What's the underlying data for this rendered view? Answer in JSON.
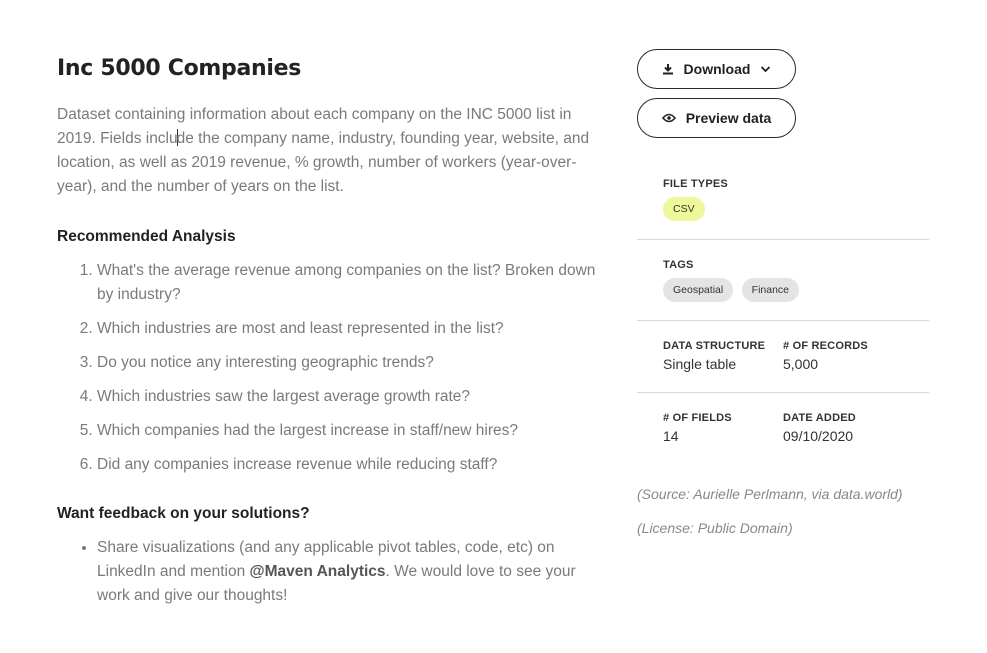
{
  "dataset": {
    "title": "Inc 5000 Companies",
    "description_part1": "Dataset containing information about each company on the INC 5000 list in 2019. Fields inclu",
    "description_part2": "de the company name, industry, founding year, website, and location, as well as 2019 revenue, % growth, number of workers (year-over-year), and the number of years on the list."
  },
  "analysis": {
    "heading": "Recommended Analysis",
    "items": [
      "What's the average revenue among companies on the list? Broken down by industry?",
      "Which industries are most and least represented in the list?",
      "Do you notice any interesting geographic trends?",
      "Which industries saw the largest average growth rate?",
      "Which companies had the largest increase in staff/new hires?",
      "Did any companies increase revenue while reducing staff?"
    ]
  },
  "feedback": {
    "heading": "Want feedback on your solutions?",
    "text_before": "Share visualizations (and any applicable pivot tables, code, etc) on LinkedIn and mention ",
    "mention": "@Maven Analytics",
    "text_after": ". We would love to see your work and give our thoughts!"
  },
  "actions": {
    "download_label": "Download",
    "preview_label": "Preview data"
  },
  "meta": {
    "file_types_label": "FILE TYPES",
    "file_types": [
      "CSV"
    ],
    "tags_label": "TAGS",
    "tags": [
      "Geospatial",
      "Finance"
    ],
    "structure_label": "DATA STRUCTURE",
    "structure_value": "Single table",
    "records_label": "# OF RECORDS",
    "records_value": "5,000",
    "fields_label": "# OF FIELDS",
    "fields_value": "14",
    "date_label": "DATE ADDED",
    "date_value": "09/10/2020"
  },
  "notes": {
    "source": "(Source: Aurielle Perlmann, via data.world)",
    "license": "(License: Public Domain)"
  },
  "colors": {
    "csv_chip": "#eef89a",
    "tag_chip": "#e4e4e4",
    "body_text": "#7a7a7a"
  },
  "icons": [
    "download-icon",
    "chevron-down-icon",
    "eye-icon",
    "text-cursor-icon"
  ]
}
